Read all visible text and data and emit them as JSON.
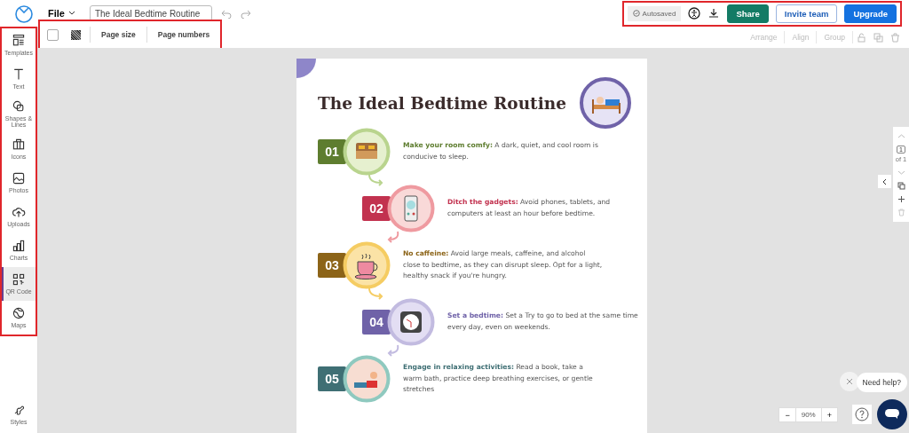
{
  "header": {
    "file_menu": "File",
    "title_field": "The Ideal Bedtime Routine",
    "autosave": "Autosaved",
    "buttons": [
      {
        "label": "Share",
        "kind": "primary-green"
      },
      {
        "label": "Invite team",
        "kind": "outline"
      },
      {
        "label": "Upgrade",
        "kind": "primary-blue"
      }
    ]
  },
  "toolbar": {
    "checkbox": {
      "checked": false
    },
    "left": [
      "Page size",
      "Page numbers"
    ],
    "right": [
      {
        "label": "Arrange",
        "disabled": true
      },
      {
        "label": "Align",
        "disabled": true
      },
      {
        "label": "Group",
        "disabled": true
      }
    ]
  },
  "sidebar": {
    "items": [
      {
        "label": "Templates",
        "kind": "templates",
        "selected": false
      },
      {
        "label": "Text",
        "kind": "text",
        "selected": false
      },
      {
        "label": "Shapes & Lines",
        "kind": "shapes",
        "selected": false
      },
      {
        "label": "Icons",
        "kind": "icons",
        "selected": false
      },
      {
        "label": "Photos",
        "kind": "photos",
        "selected": false
      },
      {
        "label": "Uploads",
        "kind": "uploads",
        "selected": false
      },
      {
        "label": "Charts",
        "kind": "charts",
        "selected": false
      },
      {
        "label": "QR Code",
        "kind": "qr",
        "selected": true
      },
      {
        "label": "Maps",
        "kind": "maps",
        "selected": false
      }
    ],
    "bottom": "Styles"
  },
  "document": {
    "title": "The Ideal Bedtime Routine",
    "steps": [
      {
        "number": "01",
        "heading": "Make your room comfy:",
        "body": " A dark, quiet, and cool room is conducive to sleep.",
        "color": "#5e7d2f",
        "kind": "bed"
      },
      {
        "number": "02",
        "heading": "Ditch the gadgets:",
        "body": " Avoid phones, tablets, and computers at least an hour before bedtime.",
        "color": "#c2324f",
        "kind": "phone"
      },
      {
        "number": "03",
        "heading": "No caffeine:",
        "body": "  Avoid large meals, caffeine, and alcohol close to bedtime, as they can disrupt sleep. Opt for a light, healthy snack if you're hungry.",
        "color": "#8c6418",
        "kind": "cup"
      },
      {
        "number": "04",
        "heading": "Set a bedtime:",
        "body": " Set a Try to go to bed at the same time every day, even on weekends.",
        "color": "#6f62a8",
        "kind": "clock"
      },
      {
        "number": "05",
        "heading": "Engage in relaxing activities:",
        "body": " Read a book, take a warm bath, practice deep breathing exercises, or gentle stretches",
        "color": "#3f6f74",
        "kind": "person"
      }
    ]
  },
  "page_nav": {
    "page": "1",
    "of": "of 1"
  },
  "zoom": {
    "value": "90%",
    "minus": "−",
    "plus": "+"
  },
  "help": {
    "bubble": "Need help?"
  }
}
